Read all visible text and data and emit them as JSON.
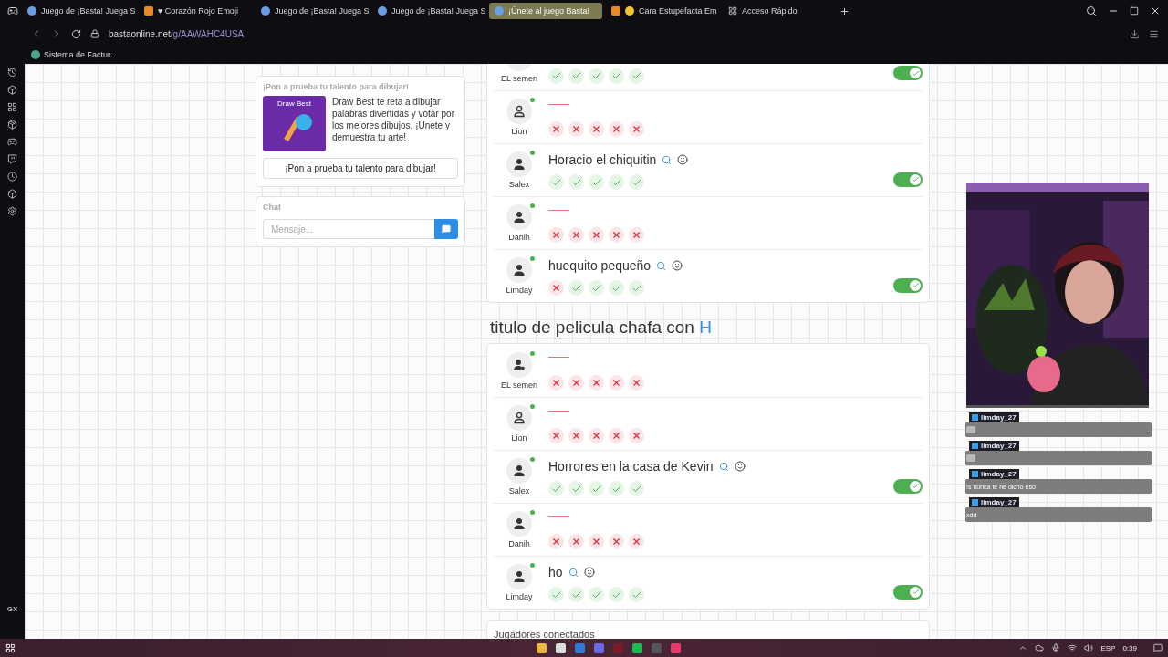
{
  "browser": {
    "tabs": [
      {
        "title": "Juego de ¡Basta! Juega S",
        "selected": false
      },
      {
        "title": "♥ Corazón Rojo Emoji",
        "selected": false
      },
      {
        "title": "Juego de ¡Basta! Juega S",
        "selected": false
      },
      {
        "title": "Juego de ¡Basta! Juega S",
        "selected": false
      },
      {
        "title": "¡Únete al juego Basta!",
        "selected": true
      },
      {
        "title": "Cara Estupefacta Em",
        "selected": false
      },
      {
        "title": "Acceso Rápido",
        "selected": false
      }
    ],
    "address": {
      "host": "bastaonline.net",
      "path": "/g/AAWAHC4USA"
    },
    "bookmarks": [
      {
        "label": "Sistema de Factur..."
      }
    ],
    "sidebar_footer": "GX"
  },
  "promo": {
    "title": "¡Pon a prueba tu talento para dibujar!",
    "image_label": "Draw Best",
    "text": "Draw Best te reta a dibujar palabras divertidas y votar por los mejores dibujos. ¡Únete y demuestra tu arte!",
    "button": "¡Pon a prueba tu talento para dibujar!"
  },
  "chat": {
    "title": "Chat",
    "placeholder": "Mensaje..."
  },
  "rounds": [
    {
      "players": [
        {
          "name": "EL semen",
          "answered": true,
          "votes": [
            true,
            true,
            true,
            true,
            true
          ],
          "approved": true
        },
        {
          "name": "Lion",
          "kind": "outline",
          "answered": false,
          "votes": [
            false,
            false,
            false,
            false,
            false
          ]
        },
        {
          "name": "Salex",
          "kind": "filled",
          "answered": true,
          "answer": "Horacio el chiquitin",
          "votes": [
            true,
            true,
            true,
            true,
            true
          ],
          "approved": true
        },
        {
          "name": "Danih",
          "kind": "filled",
          "answered": false,
          "votes": [
            false,
            false,
            false,
            false,
            false
          ]
        },
        {
          "name": "Limday",
          "kind": "filled",
          "answered": true,
          "answer": "huequito pequeño",
          "votes": [
            false,
            true,
            true,
            true,
            true
          ],
          "approved": true
        }
      ]
    },
    {
      "heading": "titulo de pelicula chafa con",
      "letter": "H",
      "players": [
        {
          "name": "EL semen",
          "kind": "host",
          "answered": false,
          "votes": [
            false,
            false,
            false,
            false,
            false
          ]
        },
        {
          "name": "Lion",
          "kind": "outline",
          "answered": false,
          "votes": [
            false,
            false,
            false,
            false,
            false
          ]
        },
        {
          "name": "Salex",
          "kind": "filled",
          "answered": true,
          "answer": "Horrores en la casa de Kevin",
          "votes": [
            true,
            true,
            true,
            true,
            true
          ],
          "approved": true
        },
        {
          "name": "Danih",
          "kind": "filled",
          "answered": false,
          "votes": [
            false,
            false,
            false,
            false,
            false
          ]
        },
        {
          "name": "Limday",
          "kind": "filled",
          "answered": true,
          "answer": "ho",
          "votes": [
            true,
            true,
            true,
            true,
            true
          ],
          "approved": true
        }
      ]
    }
  ],
  "connected": {
    "title": "Jugadores conectados"
  },
  "stream": {
    "kind": "picture",
    "messages": [
      {
        "user": "limday_27",
        "kind": "emote"
      },
      {
        "user": "limday_27",
        "kind": "emote"
      },
      {
        "user": "limday_27",
        "kind": "text",
        "text": "!s nunca te he dicho eso"
      },
      {
        "user": "limday_27",
        "kind": "text",
        "text": "xdd"
      }
    ]
  },
  "taskbar": {
    "language": "ESP",
    "time": "0:39"
  }
}
